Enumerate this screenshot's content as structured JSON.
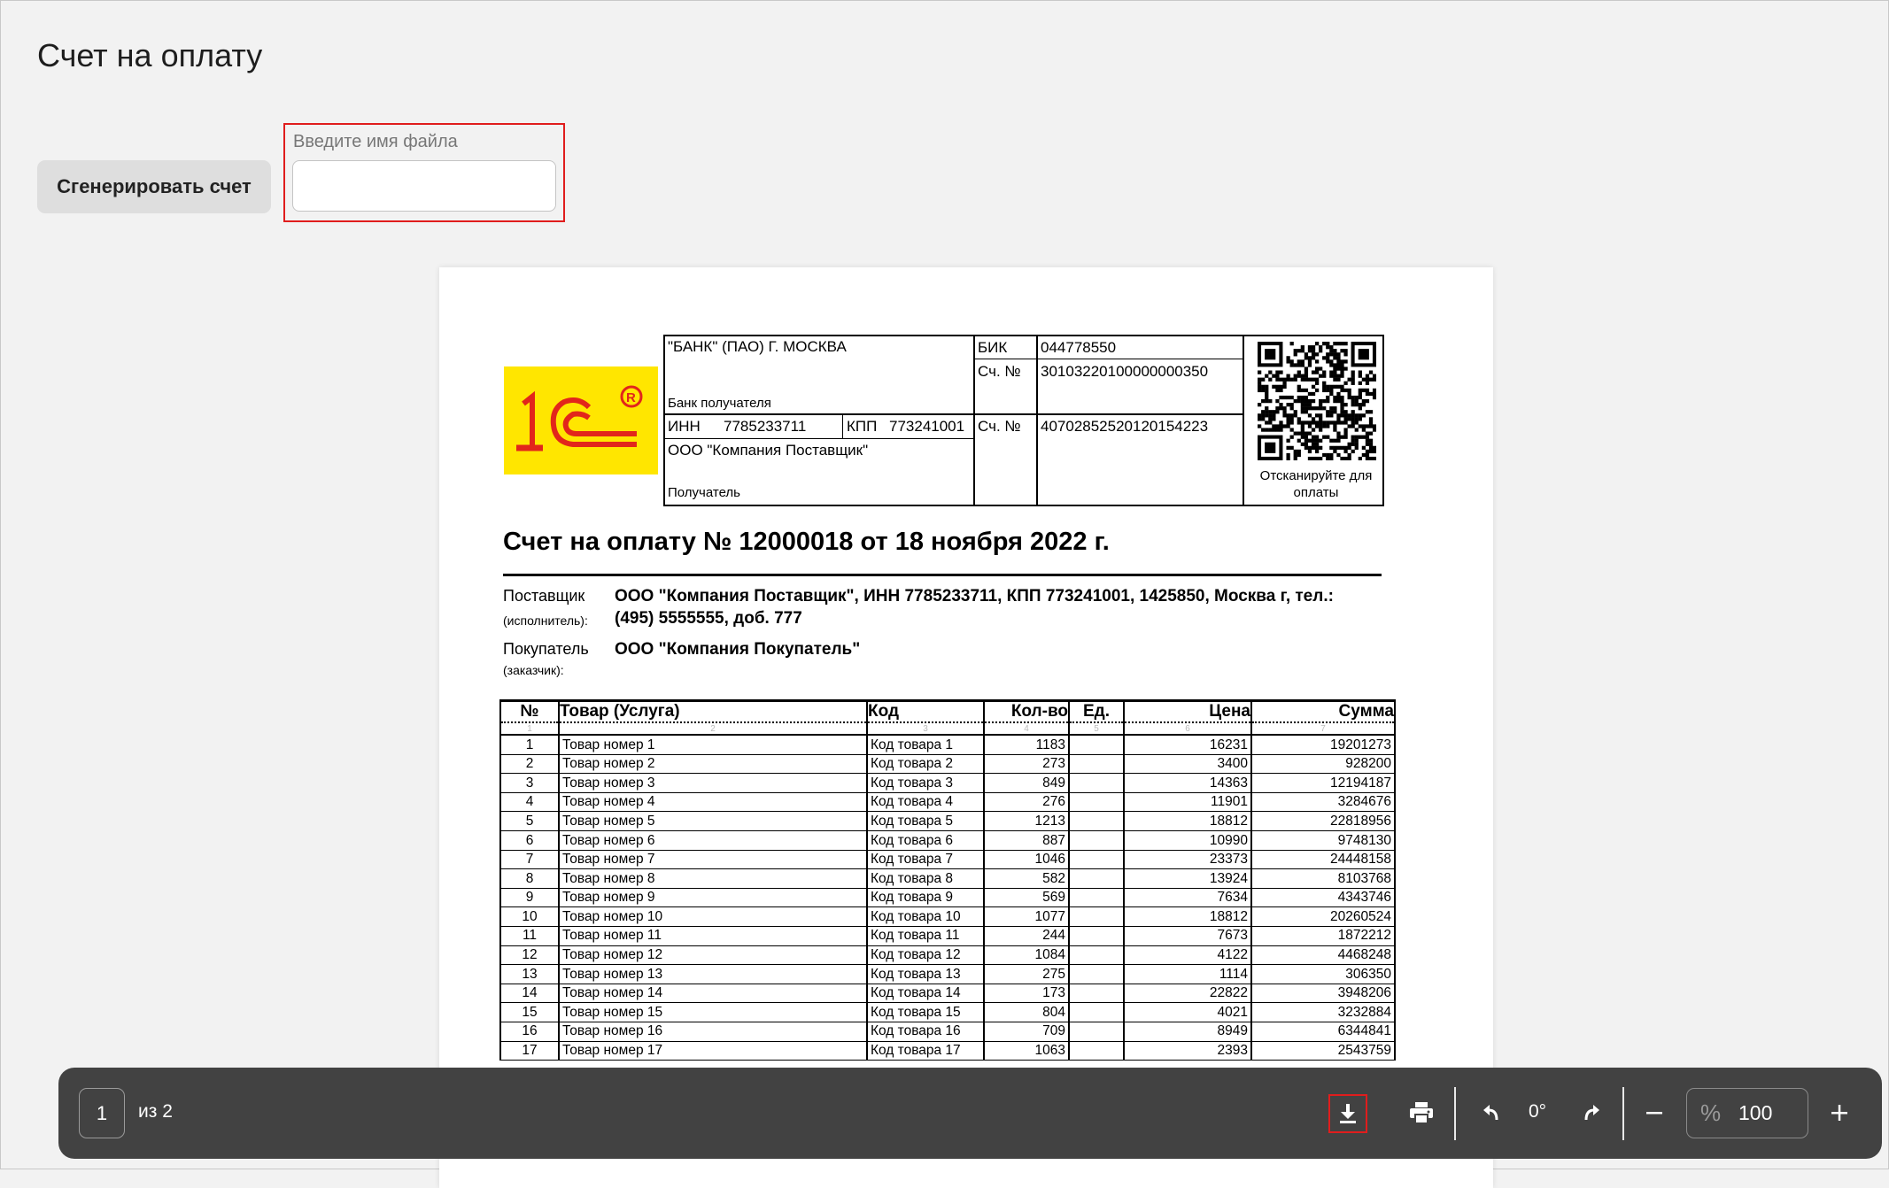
{
  "page": {
    "title": "Счет на оплату"
  },
  "controls": {
    "generate_label": "Сгенерировать счет",
    "filename_label": "Введите имя файла",
    "filename_value": "",
    "filename_placeholder": ""
  },
  "document": {
    "bank": {
      "name": "\"БАНК\" (ПАО) Г. МОСКВА",
      "bank_caption": "Банк получателя",
      "bik_label": "БИК",
      "bik": "044778550",
      "acc_label": "Сч. №",
      "corr_account": "30103220100000000350",
      "inn_label": "ИНН",
      "inn": "7785233711",
      "kpp_label": "КПП",
      "kpp": "773241001",
      "account": "40702852520120154223",
      "recipient_name": "ООО \"Компания Поставщик\"",
      "recipient_caption": "Получатель",
      "qr_caption_1": "Отсканируйте для",
      "qr_caption_2": "оплаты"
    },
    "invoice_title": "Счет на оплату № 12000018 от 18 ноября 2022 г.",
    "supplier_label": "Поставщик",
    "supplier_sub": "(исполнитель):",
    "supplier_line1": "ООО \"Компания Поставщик\",  ИНН 7785233711,  КПП 773241001, 1425850, Москва г,  тел.:",
    "supplier_line2": "(495) 5555555, доб. 777",
    "buyer_label": "Покупатель",
    "buyer_sub": "(заказчик):",
    "buyer_value": "ООО \"Компания Покупатель\"",
    "table": {
      "headers": [
        "№",
        "Товар (Услуга)",
        "Код",
        "Кол-во",
        "Ед.",
        "Цена",
        "Сумма"
      ],
      "col_numbers": [
        "1",
        "2",
        "3",
        "4",
        "5",
        "6",
        "7"
      ],
      "rows": [
        [
          "1",
          "Товар номер 1",
          "Код товара 1",
          "1183",
          "",
          "16231",
          "19201273"
        ],
        [
          "2",
          "Товар номер 2",
          "Код товара 2",
          "273",
          "",
          "3400",
          "928200"
        ],
        [
          "3",
          "Товар номер 3",
          "Код товара 3",
          "849",
          "",
          "14363",
          "12194187"
        ],
        [
          "4",
          "Товар номер 4",
          "Код товара 4",
          "276",
          "",
          "11901",
          "3284676"
        ],
        [
          "5",
          "Товар номер 5",
          "Код товара 5",
          "1213",
          "",
          "18812",
          "22818956"
        ],
        [
          "6",
          "Товар номер 6",
          "Код товара 6",
          "887",
          "",
          "10990",
          "9748130"
        ],
        [
          "7",
          "Товар номер 7",
          "Код товара 7",
          "1046",
          "",
          "23373",
          "24448158"
        ],
        [
          "8",
          "Товар номер 8",
          "Код товара 8",
          "582",
          "",
          "13924",
          "8103768"
        ],
        [
          "9",
          "Товар номер 9",
          "Код товара 9",
          "569",
          "",
          "7634",
          "4343746"
        ],
        [
          "10",
          "Товар номер 10",
          "Код товара 10",
          "1077",
          "",
          "18812",
          "20260524"
        ],
        [
          "11",
          "Товар номер 11",
          "Код товара 11",
          "244",
          "",
          "7673",
          "1872212"
        ],
        [
          "12",
          "Товар номер 12",
          "Код товара 12",
          "1084",
          "",
          "4122",
          "4468248"
        ],
        [
          "13",
          "Товар номер 13",
          "Код товара 13",
          "275",
          "",
          "1114",
          "306350"
        ],
        [
          "14",
          "Товар номер 14",
          "Код товара 14",
          "173",
          "",
          "22822",
          "3948206"
        ],
        [
          "15",
          "Товар номер 15",
          "Код товара 15",
          "804",
          "",
          "4021",
          "3232884"
        ],
        [
          "16",
          "Товар номер 16",
          "Код товара 16",
          "709",
          "",
          "8949",
          "6344841"
        ],
        [
          "17",
          "Товар номер 17",
          "Код товара 17",
          "1063",
          "",
          "2393",
          "2543759"
        ]
      ]
    }
  },
  "viewer": {
    "page_current": "1",
    "page_total": "из 2",
    "rotation": "0°",
    "zoom_symbol": "%",
    "zoom": "100",
    "icons": [
      "download-icon",
      "print-icon",
      "rotate-left-icon",
      "rotate-right-icon",
      "zoom-out-icon",
      "zoom-in-icon"
    ]
  },
  "colors": {
    "highlight": "#e01d1d",
    "toolbar": "#424242",
    "logo_bg": "#ffe600",
    "logo_red": "#e2261b"
  }
}
